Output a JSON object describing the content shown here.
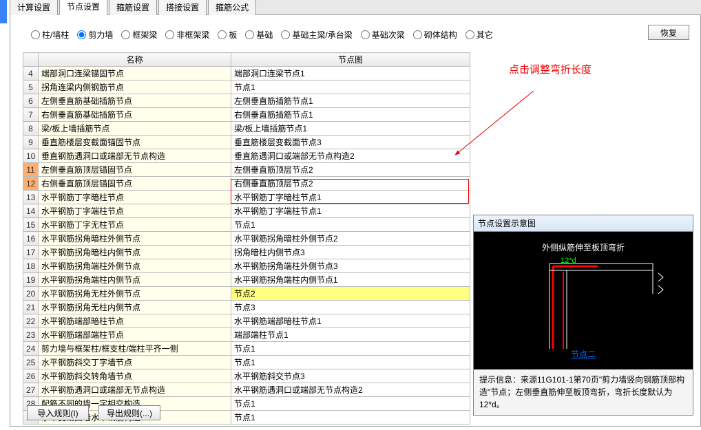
{
  "tabs": [
    "计算设置",
    "节点设置",
    "箍筋设置",
    "搭接设置",
    "箍筋公式"
  ],
  "active_tab": 1,
  "radios": [
    {
      "label": "柱/墙柱",
      "checked": false
    },
    {
      "label": "剪力墙",
      "checked": true
    },
    {
      "label": "框架梁",
      "checked": false
    },
    {
      "label": "非框架梁",
      "checked": false
    },
    {
      "label": "板",
      "checked": false
    },
    {
      "label": "基础",
      "checked": false
    },
    {
      "label": "基础主梁/承台梁",
      "checked": false
    },
    {
      "label": "基础次梁",
      "checked": false
    },
    {
      "label": "砌体结构",
      "checked": false
    },
    {
      "label": "其它",
      "checked": false
    }
  ],
  "recover_btn": "恢复",
  "columns": {
    "rownum": "",
    "name": "名称",
    "img": "节点图"
  },
  "rows": [
    {
      "n": 4,
      "name": "端部洞口连梁锚固节点",
      "img": "端部洞口连梁节点1"
    },
    {
      "n": 5,
      "name": "拐角连梁内侧钢筋节点",
      "img": "节点1"
    },
    {
      "n": 6,
      "name": "左侧垂直筋基础插筋节点",
      "img": "左侧垂直筋插筋节点1"
    },
    {
      "n": 7,
      "name": "右侧垂直筋基础插筋节点",
      "img": "右侧垂直筋插筋节点1"
    },
    {
      "n": 8,
      "name": "梁/板上墙插筋节点",
      "img": "梁/板上墙插筋节点1"
    },
    {
      "n": 9,
      "name": "垂直筋楼层变截面锚固节点",
      "img": "垂直筋楼层变截面节点3"
    },
    {
      "n": 10,
      "name": "垂直钢筋遇洞口或端部无节点构造",
      "img": "垂直筋遇洞口或端部无节点构造2"
    },
    {
      "n": 11,
      "name": "左侧垂直筋顶层锚固节点",
      "img": "左侧垂直筋顶层节点2",
      "sel": true
    },
    {
      "n": 12,
      "name": "右侧垂直筋顶层锚固节点",
      "img": "右侧垂直筋顶层节点2",
      "sel": true
    },
    {
      "n": 13,
      "name": "水平钢筋丁字暗柱节点",
      "img": "水平钢筋丁字暗柱节点1"
    },
    {
      "n": 14,
      "name": "水平钢筋丁字端柱节点",
      "img": "水平钢筋丁字端柱节点1"
    },
    {
      "n": 15,
      "name": "水平钢筋丁字无柱节点",
      "img": "节点1"
    },
    {
      "n": 16,
      "name": "水平钢筋拐角暗柱外侧节点",
      "img": "水平钢筋拐角暗柱外侧节点2"
    },
    {
      "n": 17,
      "name": "水平钢筋拐角暗柱内侧节点",
      "img": "拐角暗柱内侧节点3"
    },
    {
      "n": 18,
      "name": "水平钢筋拐角端柱外侧节点",
      "img": "水平钢筋拐角端柱外侧节点3"
    },
    {
      "n": 19,
      "name": "水平钢筋拐角端柱内侧节点",
      "img": "水平钢筋拐角端柱内侧节点1"
    },
    {
      "n": 20,
      "name": "水平钢筋拐角无柱外侧节点",
      "img": "节点2",
      "yellow": true
    },
    {
      "n": 21,
      "name": "水平钢筋拐角无柱内侧节点",
      "img": "节点3"
    },
    {
      "n": 22,
      "name": "水平钢筋端部暗柱节点",
      "img": "水平钢筋端部暗柱节点1"
    },
    {
      "n": 23,
      "name": "水平钢筋端部端柱节点",
      "img": "端部端柱节点1"
    },
    {
      "n": 24,
      "name": "剪力墙与框架柱/框支柱/端柱平齐一侧",
      "img": "节点1"
    },
    {
      "n": 25,
      "name": "水平钢筋斜交丁字墙节点",
      "img": "节点1"
    },
    {
      "n": 26,
      "name": "水平钢筋斜交转角墙节点",
      "img": "水平钢筋斜交节点3"
    },
    {
      "n": 27,
      "name": "水平钢筋遇洞口或端部无节点构造",
      "img": "水平钢筋遇洞口或端部无节点构造2"
    },
    {
      "n": 28,
      "name": "配筋不同的墙一字相交构造",
      "img": "节点1"
    },
    {
      "n": 29,
      "name": "水平变截面墙水平钢筋构造",
      "img": "节点1"
    }
  ],
  "annotation": "点击调整弯折长度",
  "preview": {
    "title": "节点设置示意图",
    "diagram_title": "外侧纵筋伸至板顶弯折",
    "dim": "12*d",
    "link": "节点二",
    "hint_label": "提示信息：",
    "hint_text": "来源11G101-1第70页\"剪力墙竖向钢筋顶部构造\"节点；左侧垂直筋伸至板顶弯折，弯折长度默认为12*d。"
  },
  "import_btn": "导入规则(I)",
  "export_btn": "导出规则(...)"
}
